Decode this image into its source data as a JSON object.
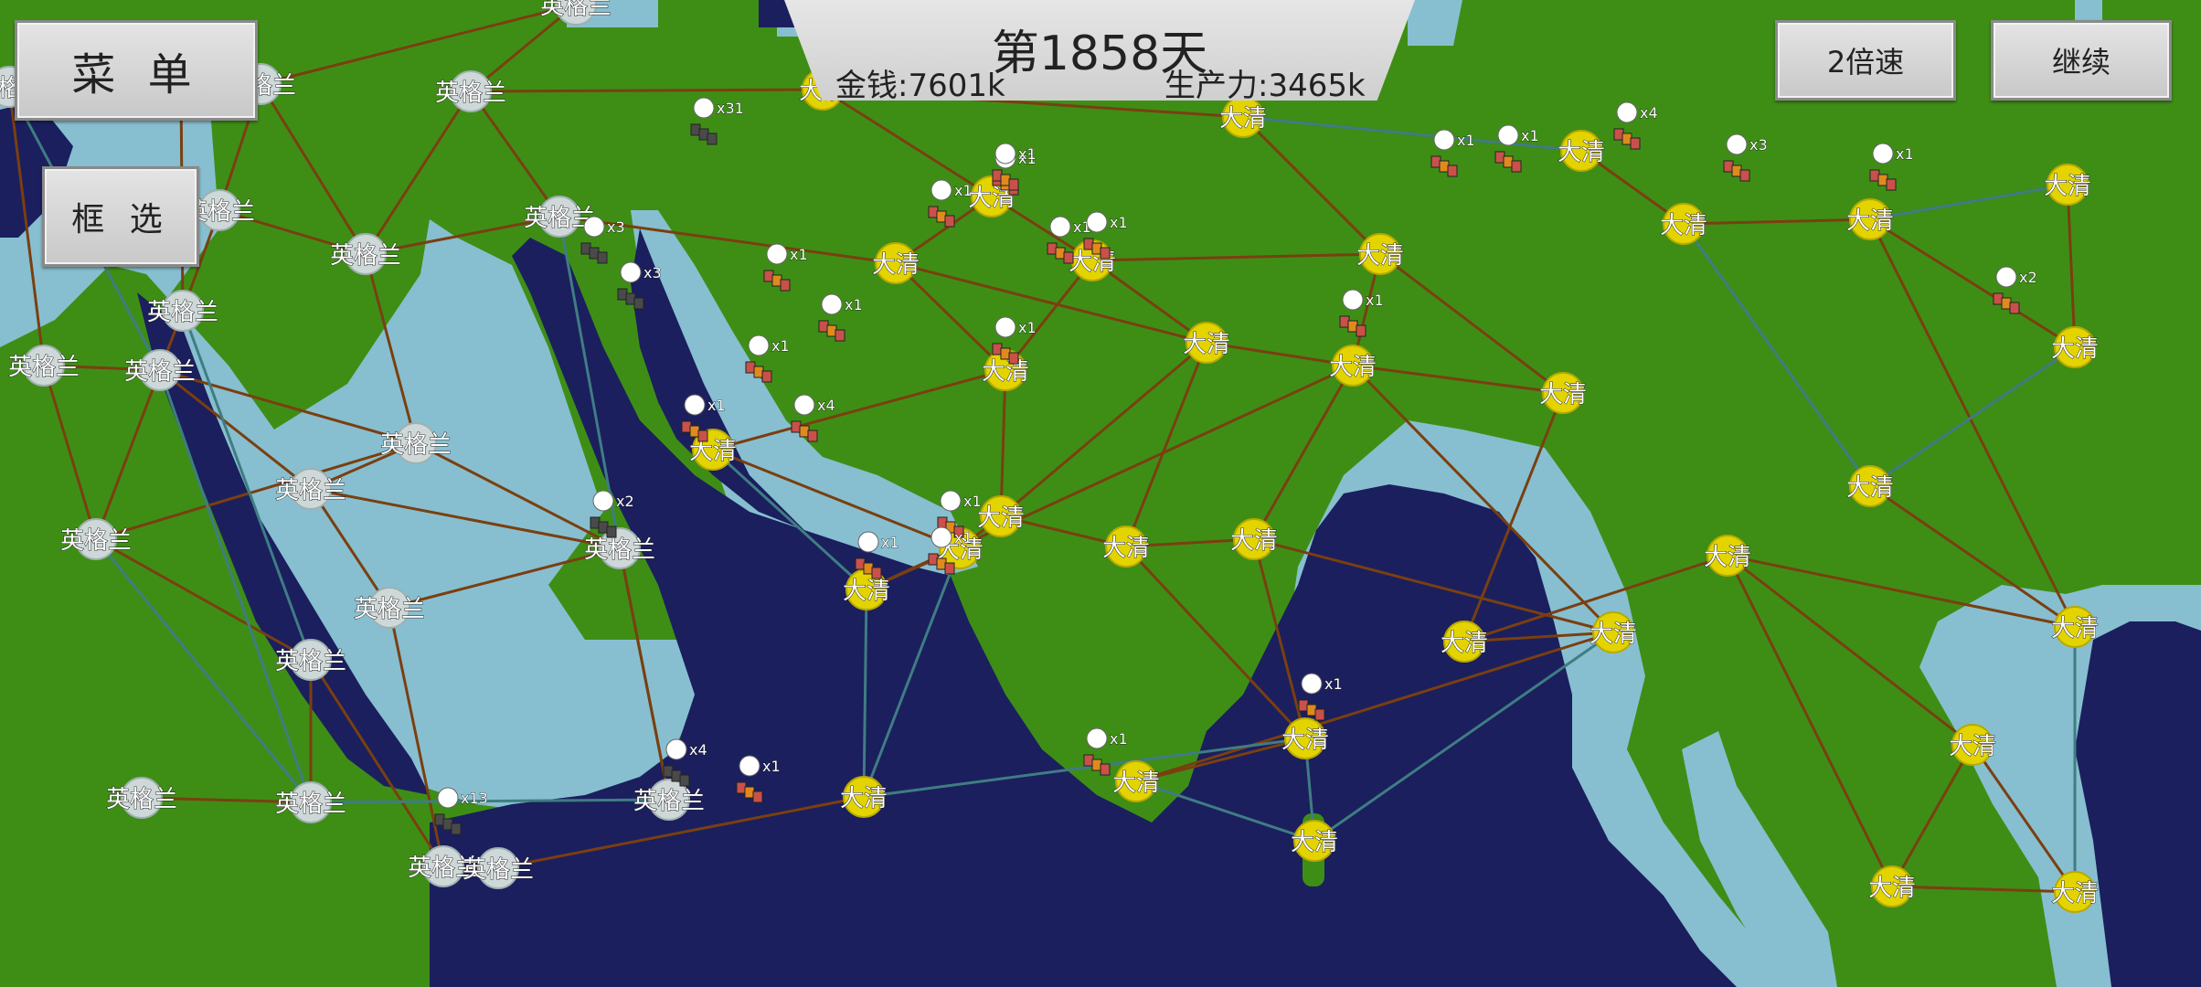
{
  "hud": {
    "day": "第1858天",
    "money": "金钱:7601k",
    "production": "生产力:3465k"
  },
  "buttons": {
    "menu": "菜 单",
    "select": "框 选",
    "speed": "2倍速",
    "continue": "继续"
  },
  "factions": {
    "england": {
      "name": "英格兰",
      "color": "#cfd8d8"
    },
    "qing": {
      "name": "大清",
      "color": "#e3d400"
    }
  },
  "colors": {
    "land": "#3e8e16",
    "deep_sea": "#1b1f5e",
    "shallow_sea": "#87bfd0",
    "land_route": "#7a3f10",
    "sea_route": "#3f7d82"
  },
  "map": {
    "nodes": [
      {
        "id": "e1",
        "owner": "england"
      },
      {
        "id": "e2",
        "owner": "england"
      },
      {
        "id": "e3",
        "owner": "england"
      },
      {
        "id": "e4",
        "owner": "england"
      },
      {
        "id": "e5",
        "owner": "england"
      },
      {
        "id": "e6",
        "owner": "england"
      },
      {
        "id": "e7",
        "owner": "england"
      },
      {
        "id": "e8",
        "owner": "england"
      },
      {
        "id": "e9",
        "owner": "england"
      },
      {
        "id": "e10",
        "owner": "england"
      },
      {
        "id": "e11",
        "owner": "england"
      },
      {
        "id": "e12",
        "owner": "england"
      },
      {
        "id": "e13",
        "owner": "england"
      },
      {
        "id": "e14",
        "owner": "england"
      },
      {
        "id": "e15",
        "owner": "england"
      },
      {
        "id": "e16",
        "owner": "england"
      },
      {
        "id": "e17",
        "owner": "england"
      },
      {
        "id": "e18",
        "owner": "england"
      },
      {
        "id": "e19",
        "owner": "england"
      },
      {
        "id": "e20",
        "owner": "england"
      },
      {
        "id": "e21",
        "owner": "england"
      },
      {
        "id": "e22",
        "owner": "england"
      },
      {
        "id": "q1",
        "owner": "qing"
      },
      {
        "id": "q2",
        "owner": "qing"
      },
      {
        "id": "q3",
        "owner": "qing"
      },
      {
        "id": "q4",
        "owner": "qing"
      },
      {
        "id": "q5",
        "owner": "qing"
      },
      {
        "id": "q6",
        "owner": "qing"
      },
      {
        "id": "q7",
        "owner": "qing"
      },
      {
        "id": "q8",
        "owner": "qing"
      },
      {
        "id": "q9",
        "owner": "qing"
      },
      {
        "id": "q10",
        "owner": "qing"
      },
      {
        "id": "q11",
        "owner": "qing"
      },
      {
        "id": "q12",
        "owner": "qing"
      },
      {
        "id": "q13",
        "owner": "qing"
      },
      {
        "id": "q14",
        "owner": "qing"
      },
      {
        "id": "q15",
        "owner": "qing"
      },
      {
        "id": "q16",
        "owner": "qing"
      },
      {
        "id": "q17",
        "owner": "qing"
      },
      {
        "id": "q18",
        "owner": "qing"
      },
      {
        "id": "q19",
        "owner": "qing"
      },
      {
        "id": "q20",
        "owner": "qing"
      },
      {
        "id": "q21",
        "owner": "qing"
      },
      {
        "id": "q22",
        "owner": "qing"
      },
      {
        "id": "q23",
        "owner": "qing"
      },
      {
        "id": "q24",
        "owner": "qing"
      },
      {
        "id": "q25",
        "owner": "qing"
      },
      {
        "id": "q26",
        "owner": "qing"
      },
      {
        "id": "q27",
        "owner": "qing"
      },
      {
        "id": "q28",
        "owner": "qing"
      },
      {
        "id": "q29",
        "owner": "qing"
      },
      {
        "id": "q30",
        "owner": "qing"
      },
      {
        "id": "q31",
        "owner": "qing"
      },
      {
        "id": "q32",
        "owner": "qing"
      },
      {
        "id": "q33",
        "owner": "qing"
      }
    ],
    "units": [
      {
        "id": "u1",
        "side": "england",
        "count": "x3"
      },
      {
        "id": "u2",
        "side": "england",
        "count": "x3"
      },
      {
        "id": "u3",
        "side": "england",
        "count": "x31"
      },
      {
        "id": "u4",
        "side": "england",
        "count": "x2"
      },
      {
        "id": "u5",
        "side": "england",
        "count": "x4"
      },
      {
        "id": "u6",
        "side": "england",
        "count": "x13"
      },
      {
        "id": "u7",
        "side": "qing",
        "count": "x1"
      },
      {
        "id": "u8",
        "side": "qing",
        "count": "x1"
      },
      {
        "id": "u9",
        "side": "qing",
        "count": "x1"
      },
      {
        "id": "u10",
        "side": "qing",
        "count": "x4"
      },
      {
        "id": "u11",
        "side": "qing",
        "count": "x1"
      },
      {
        "id": "u12",
        "side": "qing",
        "count": "x1"
      },
      {
        "id": "u13",
        "side": "qing",
        "count": "x1"
      },
      {
        "id": "u14",
        "side": "qing",
        "count": "x1"
      },
      {
        "id": "u15",
        "side": "qing",
        "count": "x1"
      },
      {
        "id": "u16",
        "side": "qing",
        "count": "x1"
      },
      {
        "id": "u17",
        "side": "qing",
        "count": "x1"
      },
      {
        "id": "u18",
        "side": "qing",
        "count": "x1"
      },
      {
        "id": "u19",
        "side": "qing",
        "count": "x1"
      },
      {
        "id": "u20",
        "side": "qing",
        "count": "x1"
      },
      {
        "id": "u21",
        "side": "qing",
        "count": "x1"
      },
      {
        "id": "u22",
        "side": "qing",
        "count": "x1"
      },
      {
        "id": "u23",
        "side": "qing",
        "count": "x4"
      },
      {
        "id": "u24",
        "side": "qing",
        "count": "x1"
      },
      {
        "id": "u25",
        "side": "qing",
        "count": "x3"
      },
      {
        "id": "u26",
        "side": "qing",
        "count": "x2"
      },
      {
        "id": "u27",
        "side": "qing",
        "count": "x1"
      },
      {
        "id": "u28",
        "side": "qing",
        "count": "x1"
      },
      {
        "id": "u29",
        "side": "qing",
        "count": "x1"
      },
      {
        "id": "u30",
        "side": "qing",
        "count": "x1"
      }
    ]
  }
}
